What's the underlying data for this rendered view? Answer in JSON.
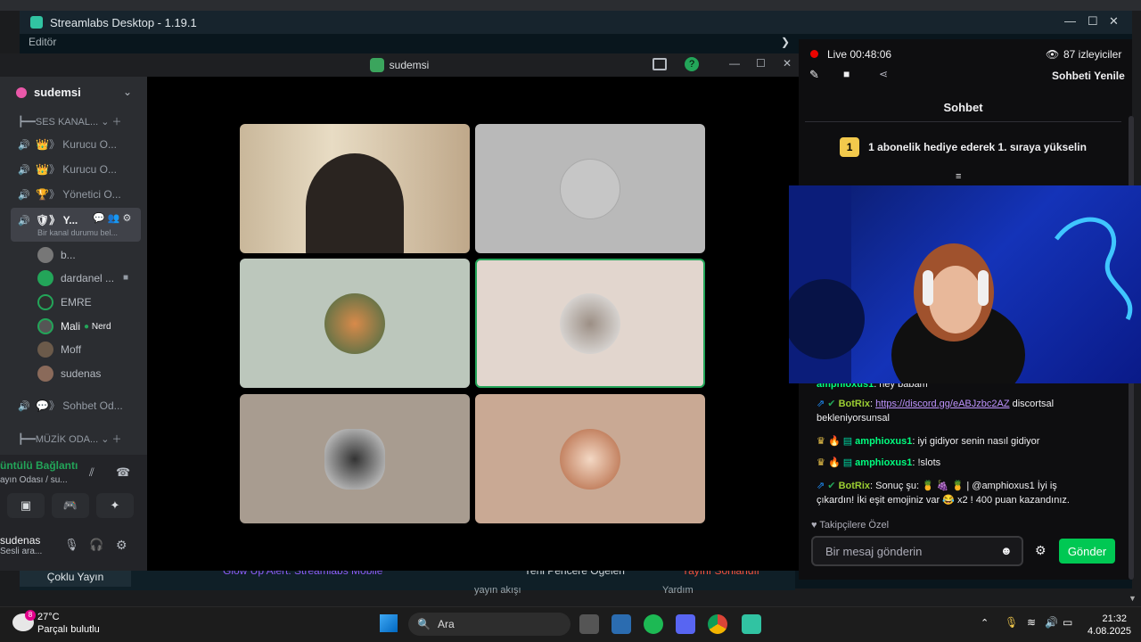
{
  "streamlabs": {
    "title": "Streamlabs Desktop - 1.19.1",
    "editor": "Editör",
    "coklu_yayin": "Çoklu Yayın",
    "glow_alert": "Glow Up Alert: Streamlabs Mobile",
    "pencere": "Yeni Pencere Oğeleri",
    "yayini": "Yayını Sonlandır",
    "yayin_akisi": "yayın akışı",
    "yardim": "Yardım"
  },
  "discord": {
    "window_title": "sudemsi",
    "server_name": "sudemsi",
    "category_voice": "SES KANAL...",
    "channels": [
      {
        "label": "》 Kurucu O..."
      },
      {
        "label": "》 Kurucu O..."
      },
      {
        "label": "》 Yönetici O..."
      }
    ],
    "selected_channel": "》 Y...",
    "selected_status": "Bir kanal durumu bel...",
    "users": [
      {
        "name": "b..."
      },
      {
        "name": "dardanel ..."
      },
      {
        "name": "EMRE"
      },
      {
        "name": "Mali"
      },
      {
        "name": "Moff"
      },
      {
        "name": "sudenas"
      }
    ],
    "nerd_tag": "Nerd",
    "text_channel": "》 Sohbet Od...",
    "category_music": "MÜZİK ODA...",
    "voice_connected": "üntülü Bağlantı",
    "voice_sub": "ayın Odası / su...",
    "me_name": "sudenas",
    "me_sub": "Sesli ara..."
  },
  "twitch": {
    "live": "Live 00:48:06",
    "viewers": "87 izleyiciler",
    "refresh": "Sohbeti Yenile",
    "chat_title": "Sohbet",
    "gift_rank": "1",
    "gift_text": "1 abonelik hediye ederek 1. sıraya yükselin",
    "messages": [
      {
        "user": "amphioxus1",
        "text": ": hey babam"
      },
      {
        "user": "BotRix",
        "link": "https://discord.gg/eABJzbc2AZ",
        "text": " discortsal bekleniyorsunsal"
      },
      {
        "user": "amphioxus1",
        "text": ": iyi gidiyor senin nasıl gidiyor"
      },
      {
        "user": "amphioxus1",
        "text": ": !slots"
      },
      {
        "user": "BotRix",
        "text": ": Sonuç şu: 🍍 🍇 🍍 | @amphioxus1 İyi iş çıkardın! İki eşit emojiniz var 😂 x2 ! 400 puan kazandınız."
      }
    ],
    "followers_only": "Takipçilere Özel",
    "input_placeholder": "Bir mesaj gönderin",
    "send": "Gönder"
  },
  "taskbar": {
    "temp": "27°C",
    "weather": "Parçalı bulutlu",
    "weather_badge": "8",
    "search": "Ara",
    "time": "21:32",
    "date": "4.08.2025"
  },
  "colors": {
    "discord_green": "#23a559",
    "twitch_send": "#00c853",
    "live_red": "#eb0400"
  }
}
